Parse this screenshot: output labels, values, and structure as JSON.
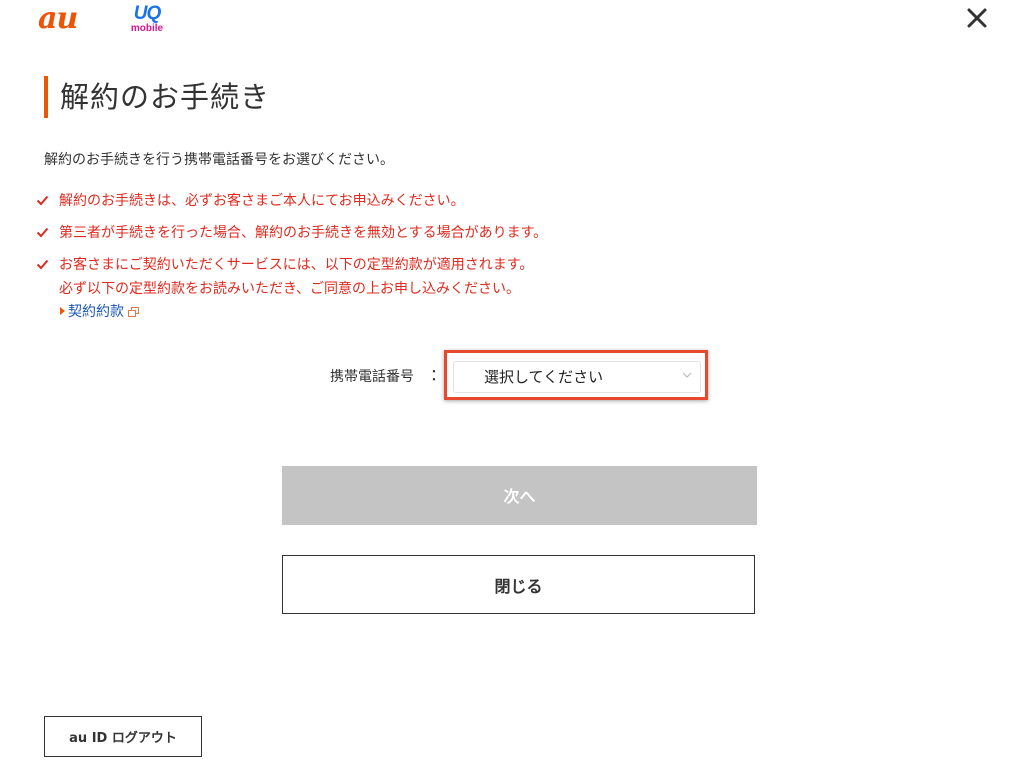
{
  "header": {
    "logo_au": "au",
    "logo_uq": "UQ",
    "logo_uq_sub": "mobile",
    "close_icon": "close-icon"
  },
  "main": {
    "title": "解約のお手続き",
    "intro": "解約のお手続きを行う携帯電話番号をお選びください。",
    "notes": [
      {
        "text": "解約のお手続きは、必ずお客さまご本人にてお申込みください。"
      },
      {
        "text": "第三者が手続きを行った場合、解約のお手続きを無効とする場合があります。"
      },
      {
        "text": "お客さまにご契約いただくサービスには、以下の定型約款が適用されます。",
        "text2": "必ず以下の定型約款をお読みいただき、ご同意の上お申し込みください。"
      }
    ],
    "terms_link": "契約約款",
    "phone_label": "携帯電話番号",
    "phone_colon": "：",
    "select_value": "選択してください",
    "next_button": "次へ",
    "close_button": "閉じる",
    "logout_button": "au ID ログアウト"
  },
  "colors": {
    "brand_orange": "#eb5505",
    "warning_red": "#e02a1f",
    "link_blue": "#1a57b8",
    "highlight_frame": "#e8482f",
    "disabled_button": "#c4c4c4"
  },
  "icons": [
    "close-icon",
    "check-icon",
    "external-link-icon",
    "chevron-down-icon",
    "arrow-right-icon"
  ]
}
